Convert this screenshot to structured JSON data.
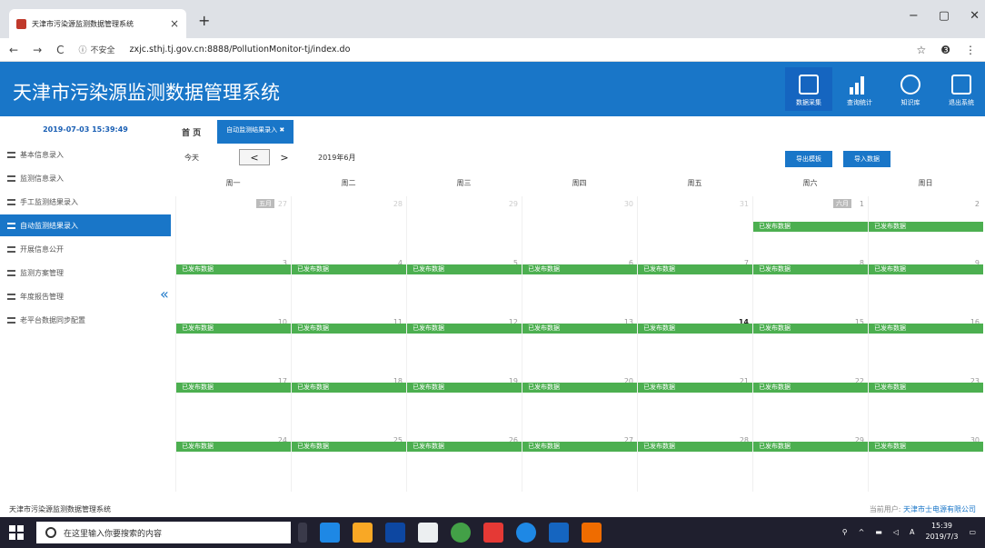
{
  "browser": {
    "tab_title": "天津市污染源监测数据管理系统",
    "tab_close": "×",
    "new_tab": "+",
    "nav_back": "←",
    "nav_forward": "→",
    "nav_reload": "C",
    "security_icon": "ⓘ",
    "security_label": "不安全",
    "url": "zxjc.sthj.tj.gov.cn:8888/PollutionMonitor-tj/index.do",
    "star": "☆",
    "profile": "❸",
    "menu": "⋮",
    "win_min": "−",
    "win_max": "▢",
    "win_close": "✕"
  },
  "header": {
    "title": "天津市污染源监测数据管理系统",
    "buttons": [
      {
        "label": "数据采集",
        "icon": "data-collect-icon"
      },
      {
        "label": "查询统计",
        "icon": "bar-chart-icon"
      },
      {
        "label": "知识库",
        "icon": "database-icon"
      },
      {
        "label": "退出系统",
        "icon": "exit-icon"
      }
    ]
  },
  "datetime": "2019-07-03 15:39:49",
  "tabs": {
    "home": "首 页",
    "active": "自动监测结果录入 ✖"
  },
  "sidebar": {
    "items": [
      {
        "label": "基本信息录入",
        "active": false
      },
      {
        "label": "监测信息录入",
        "active": false
      },
      {
        "label": "手工监测结果录入",
        "active": false
      },
      {
        "label": "自动监测结果录入",
        "active": true
      },
      {
        "label": "开展信息公开",
        "active": false
      },
      {
        "label": "监测方案管理",
        "active": false
      },
      {
        "label": "年度报告管理",
        "active": false
      },
      {
        "label": "老平台数据同步配置",
        "active": false
      }
    ],
    "collapse": "«"
  },
  "calendar": {
    "today_btn": "今天",
    "prev": "<",
    "next": ">",
    "month_label": "2019年6月",
    "export_btn": "导出模板",
    "import_btn": "导入数据",
    "weekdays": [
      "周一",
      "周二",
      "周三",
      "周四",
      "周五",
      "周六",
      "周日"
    ],
    "event_label": "已发布数据",
    "weeks": [
      {
        "days": [
          {
            "n": "27",
            "prev": true,
            "tag": "五月"
          },
          {
            "n": "28",
            "prev": true
          },
          {
            "n": "29",
            "prev": true
          },
          {
            "n": "30",
            "prev": true
          },
          {
            "n": "31",
            "prev": true
          },
          {
            "n": "1",
            "tag": "六月",
            "event": true
          },
          {
            "n": "2",
            "event": true
          }
        ],
        "event_row": "first"
      },
      {
        "days": [
          {
            "n": "3",
            "event": true
          },
          {
            "n": "4",
            "event": true
          },
          {
            "n": "5",
            "event": true
          },
          {
            "n": "6",
            "event": true
          },
          {
            "n": "7",
            "event": true
          },
          {
            "n": "8",
            "event": true
          },
          {
            "n": "9",
            "event": true
          }
        ]
      },
      {
        "days": [
          {
            "n": "10",
            "event": true
          },
          {
            "n": "11",
            "event": true
          },
          {
            "n": "12",
            "event": true
          },
          {
            "n": "13",
            "event": true
          },
          {
            "n": "14",
            "today": true,
            "event": true
          },
          {
            "n": "15",
            "event": true
          },
          {
            "n": "16",
            "event": true
          }
        ]
      },
      {
        "days": [
          {
            "n": "17",
            "event": true
          },
          {
            "n": "18",
            "event": true
          },
          {
            "n": "19",
            "event": true
          },
          {
            "n": "20",
            "event": true
          },
          {
            "n": "21",
            "event": true
          },
          {
            "n": "22",
            "event": true
          },
          {
            "n": "23",
            "event": true
          }
        ]
      },
      {
        "days": [
          {
            "n": "24",
            "event": true
          },
          {
            "n": "25",
            "event": true
          },
          {
            "n": "26",
            "event": true
          },
          {
            "n": "27",
            "event": true
          },
          {
            "n": "28",
            "event": true
          },
          {
            "n": "29",
            "event": true
          },
          {
            "n": "30",
            "event": true
          }
        ]
      }
    ]
  },
  "footer": {
    "left": "天津市污染源监测数据管理系统",
    "right_label": "当前用户:",
    "right_user": "天津市士电源有限公司"
  },
  "taskbar": {
    "search_placeholder": "在这里输入你要搜索的内容",
    "clock_time": "15:39",
    "clock_date": "2019/7/3",
    "lang": "A"
  },
  "colors": {
    "brand": "#1976c8",
    "event": "#4caf50"
  }
}
